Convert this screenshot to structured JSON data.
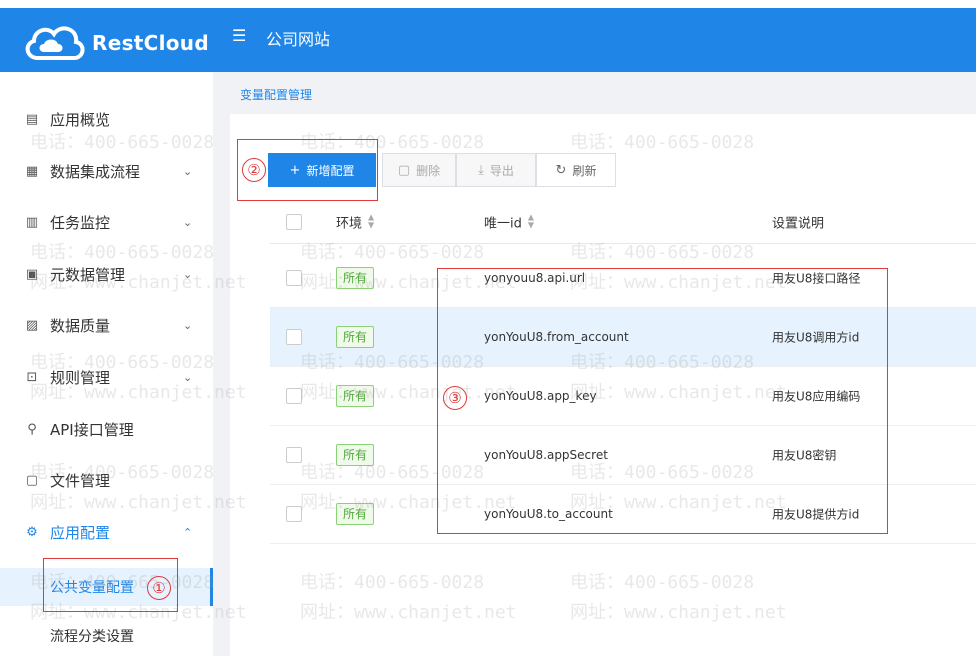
{
  "header": {
    "brand": "RestCloud",
    "menu_toggle_icon": "menu-fold-icon",
    "site_title": "公司网站"
  },
  "sidebar": {
    "items": [
      {
        "label": "应用概览",
        "icon": "overview-icon",
        "arrow": ""
      },
      {
        "label": "数据集成流程",
        "icon": "grid-icon",
        "arrow": "⌄"
      },
      {
        "label": "任务监控",
        "icon": "monitor-icon",
        "arrow": "⌄"
      },
      {
        "label": "元数据管理",
        "icon": "metadata-icon",
        "arrow": "⌄"
      },
      {
        "label": "数据质量",
        "icon": "quality-icon",
        "arrow": "⌄"
      },
      {
        "label": "规则管理",
        "icon": "rule-icon",
        "arrow": "⌄"
      },
      {
        "label": "API接口管理",
        "icon": "api-icon",
        "arrow": ""
      },
      {
        "label": "文件管理",
        "icon": "file-icon",
        "arrow": ""
      },
      {
        "label": "应用配置",
        "icon": "gear-icon",
        "arrow": "⌃"
      }
    ],
    "sub_items": [
      {
        "label": "公共变量配置",
        "active": true
      },
      {
        "label": "流程分类设置",
        "active": false
      }
    ]
  },
  "breadcrumb": "变量配置管理",
  "toolbar": {
    "add_label": "新增配置",
    "delete_label": "删除",
    "export_label": "导出",
    "refresh_label": "刷新"
  },
  "table": {
    "columns": {
      "env": "环境",
      "id": "唯一id",
      "desc": "设置说明"
    },
    "rows": [
      {
        "env": "所有",
        "id": "yonyouu8.api.url",
        "desc": "用友U8接口路径"
      },
      {
        "env": "所有",
        "id": "yonYouU8.from_account",
        "desc": "用友U8调用方id"
      },
      {
        "env": "所有",
        "id": "yonYouU8.app_key",
        "desc": "用友U8应用编码"
      },
      {
        "env": "所有",
        "id": "yonYouU8.appSecret",
        "desc": "用友U8密钥"
      },
      {
        "env": "所有",
        "id": "yonYouU8.to_account",
        "desc": "用友U8提供方id"
      }
    ]
  },
  "annotations": {
    "one": "①",
    "two": "②",
    "three": "③"
  },
  "watermark": {
    "phone": "电话：400-665-0028",
    "site": "网址：www.chanjet.net"
  },
  "colors": {
    "primary": "#1f86e8",
    "annotation": "#e03a3a",
    "tag_green": "#52a83c"
  }
}
